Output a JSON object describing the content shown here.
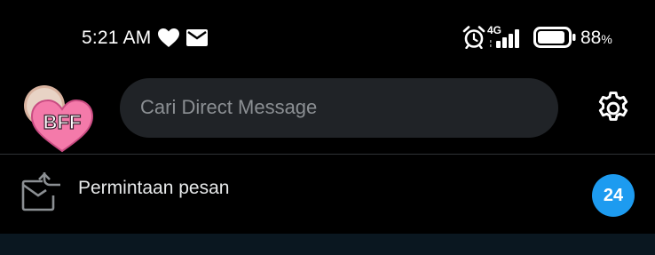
{
  "status_bar": {
    "time": "5:21 AM",
    "network": "4G",
    "battery_value": "88",
    "battery_unit": "%",
    "battery_level": 0.88,
    "icons": [
      "heart-icon",
      "mail-icon",
      "alarm-icon",
      "signal-icon",
      "battery-icon"
    ]
  },
  "header": {
    "avatar_text": "BFF",
    "search_placeholder": "Cari Direct Message",
    "settings_icon": "gear-icon"
  },
  "message_requests": {
    "label": "Permintaan pesan",
    "count": "24",
    "icon": "mail-incoming-icon",
    "badge_color": "#1d9bf0"
  },
  "colors": {
    "background": "#000000",
    "search_bg": "#202327",
    "divider": "#2f3336",
    "accent": "#1d9bf0"
  }
}
